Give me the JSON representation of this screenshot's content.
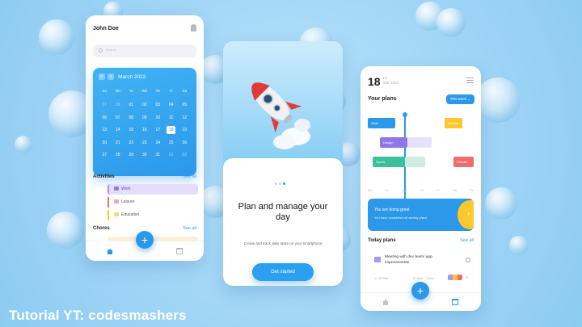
{
  "phone_profile": {
    "user_name": "John Doe",
    "search_placeholder": "Search",
    "calendar": {
      "month": "March 2022",
      "prev": "<",
      "next": ">",
      "weekdays": [
        "Su",
        "Mo",
        "Tu",
        "We",
        "Th",
        "Fr",
        "Sa"
      ],
      "weeks": [
        [
          "27",
          "28",
          "01",
          "02",
          "03",
          "04",
          "05"
        ],
        [
          "06",
          "07",
          "08",
          "09",
          "10",
          "11",
          "12"
        ],
        [
          "13",
          "14",
          "15",
          "16",
          "17",
          "18",
          "19"
        ],
        [
          "20",
          "21",
          "22",
          "23",
          "24",
          "25",
          "26"
        ],
        [
          "27",
          "28",
          "29",
          "30",
          "31",
          "01",
          "02"
        ]
      ],
      "selected": "18"
    },
    "activities": {
      "title": "Activities",
      "see_all": "See all",
      "items": [
        "Work",
        "Leisure",
        "Education"
      ]
    },
    "chores": {
      "title": "Chores",
      "see_all": "See all"
    },
    "fab": "+"
  },
  "phone_onboarding": {
    "title": "Plan and manage your day",
    "subtitle": "Create and track daily tasks on your smartphone",
    "button": "Get started"
  },
  "phone_plans": {
    "day": "18",
    "weekday": "Fri",
    "month_year": "Mar 2022",
    "your_plans": "Your plans",
    "range_button": "This week",
    "bars": [
      {
        "label": "Work",
        "color": "#2b98ea"
      },
      {
        "label": "Leisure",
        "color": "#fcc82e"
      },
      {
        "label": "Design",
        "color": "#8f77e8"
      },
      {
        "label": "Sports",
        "color": "#3cbf9b"
      },
      {
        "label": "Chores",
        "color": "#f06d6d"
      }
    ],
    "days": [
      "Mo",
      "Tu",
      "We",
      "Th",
      "Fr",
      "Sa",
      "Su"
    ],
    "banner": {
      "title": "You are doing great",
      "text": "You have completed all weekly plans"
    },
    "today": {
      "title": "Today plans",
      "see_all": "See all"
    },
    "task": {
      "title": "Meeting with dev team/ app improvements",
      "date": "18 Mar",
      "time": "9pm - 11pm",
      "extra": "+1"
    },
    "fab": "+"
  },
  "caption": "Tutorial YT: codesmashers",
  "colors": {
    "accent": "#2b98ea",
    "background": "#9fd6f7"
  }
}
